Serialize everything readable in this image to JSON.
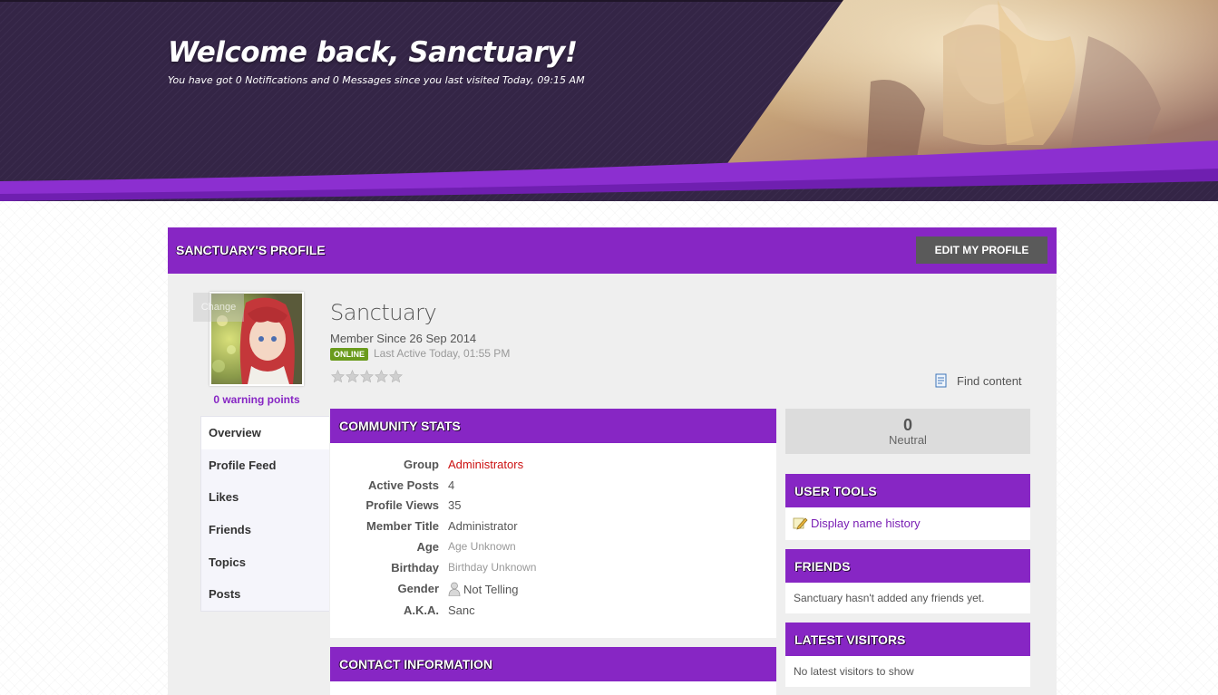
{
  "header": {
    "welcome_title": "Welcome back, Sanctuary!",
    "welcome_subtitle": "You have got 0 Notifications and 0 Messages since you last visited Today, 09:15 AM"
  },
  "profile_bar": {
    "title": "SANCTUARY'S PROFILE",
    "edit_button": "EDIT MY PROFILE"
  },
  "avatar": {
    "change_label": "Change",
    "warning_points": "0 warning points"
  },
  "side_nav": {
    "items": [
      {
        "label": "Overview",
        "active": true
      },
      {
        "label": "Profile Feed",
        "active": false
      },
      {
        "label": "Likes",
        "active": false
      },
      {
        "label": "Friends",
        "active": false
      },
      {
        "label": "Topics",
        "active": false
      },
      {
        "label": "Posts",
        "active": false
      }
    ]
  },
  "user": {
    "name": "Sanctuary",
    "member_since": "Member Since 26 Sep 2014",
    "status_badge": "ONLINE",
    "last_active": "Last Active Today, 01:55 PM",
    "rating_stars": 0,
    "rating_max": 5,
    "find_content": "Find content"
  },
  "community_stats": {
    "title": "COMMUNITY STATS",
    "rows": [
      {
        "label": "Group",
        "value": "Administrators"
      },
      {
        "label": "Active Posts",
        "value": "4"
      },
      {
        "label": "Profile Views",
        "value": "35"
      },
      {
        "label": "Member Title",
        "value": "Administrator"
      },
      {
        "label": "Age",
        "value": "Age Unknown"
      },
      {
        "label": "Birthday",
        "value": "Birthday Unknown"
      },
      {
        "label": "Gender",
        "value": "Not Telling"
      },
      {
        "label": "A.K.A.",
        "value": "Sanc"
      }
    ]
  },
  "contact_info": {
    "title": "CONTACT INFORMATION"
  },
  "reputation": {
    "value": "0",
    "label": "Neutral"
  },
  "user_tools": {
    "title": "USER TOOLS",
    "link": "Display name history"
  },
  "friends": {
    "title": "FRIENDS",
    "note": "Sanctuary hasn't added any friends yet."
  },
  "latest_visitors": {
    "title": "LATEST VISITORS",
    "note": "No latest visitors to show"
  },
  "colors": {
    "accent_purple": "#8726c4",
    "header_dark": "#3a2a4a",
    "link_purple": "#7a1fb4",
    "group_red": "#cc1111",
    "online_green": "#6a9b1c"
  }
}
